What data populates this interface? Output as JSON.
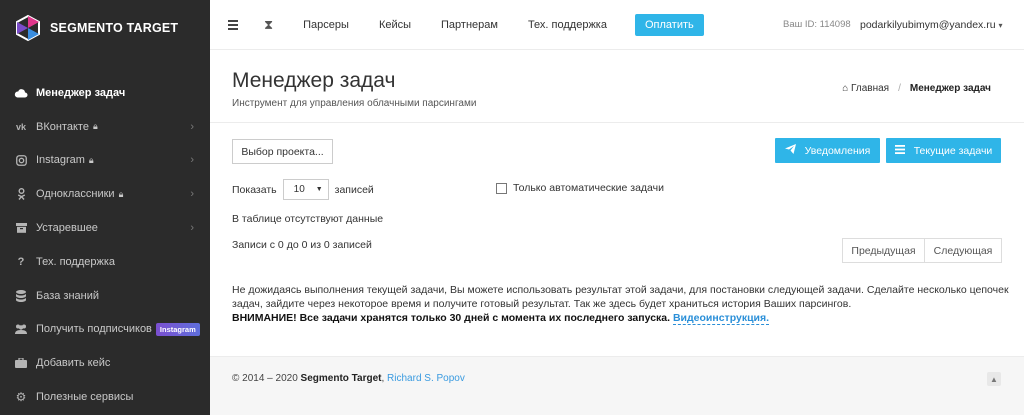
{
  "brand": {
    "title": "SEGMENTO TARGET"
  },
  "sidebar": {
    "items": [
      {
        "label": "Менеджер задач",
        "icon": "cloud-icon",
        "active": true,
        "locked": false,
        "chevron": false
      },
      {
        "label": "ВКонтакте",
        "icon": "vk-icon",
        "active": false,
        "locked": true,
        "chevron": true
      },
      {
        "label": "Instagram",
        "icon": "instagram-icon",
        "active": false,
        "locked": true,
        "chevron": true
      },
      {
        "label": "Одноклассники",
        "icon": "ok-icon",
        "active": false,
        "locked": true,
        "chevron": true
      },
      {
        "label": "Устаревшее",
        "icon": "archive-icon",
        "active": false,
        "locked": false,
        "chevron": true
      },
      {
        "label": "Тех. поддержка",
        "icon": "question-icon",
        "active": false,
        "locked": false,
        "chevron": false
      },
      {
        "label": "База знаний",
        "icon": "database-icon",
        "active": false,
        "locked": false,
        "chevron": false
      },
      {
        "label": "Получить подписчиков",
        "icon": "users-icon",
        "active": false,
        "locked": false,
        "chevron": false,
        "badge": "Instagram"
      },
      {
        "label": "Добавить кейс",
        "icon": "briefcase-icon",
        "active": false,
        "locked": false,
        "chevron": false
      },
      {
        "label": "Полезные сервисы",
        "icon": "cogs-icon",
        "active": false,
        "locked": false,
        "chevron": false
      }
    ]
  },
  "topbar": {
    "links": [
      "Парсеры",
      "Кейсы",
      "Партнерам",
      "Тех. поддержка"
    ],
    "pay_label": "Оплатить",
    "user_id": "Ваш ID: 114098",
    "user_email": "podarkilyubimym@yandex.ru"
  },
  "header": {
    "title": "Менеджер задач",
    "subtitle": "Инструмент для управления облачными парсингами",
    "breadcrumb_home": "Главная",
    "breadcrumb_current": "Менеджер задач"
  },
  "content": {
    "project_select": "Выбор проекта...",
    "notifications_label": "Уведомления",
    "current_tasks_label": "Текущие задачи",
    "show_label": "Показать",
    "page_size": "10",
    "entries_label": "записей",
    "auto_only_label": "Только автоматические задачи",
    "empty_text": "В таблице отсутствуют данные",
    "records_info": "Записи с 0 до 0 из 0 записей",
    "prev_label": "Предыдущая",
    "next_label": "Следующая",
    "notice_text": "Не дожидаясь выполнения текущей задачи, Вы можете использовать результат этой задачи, для постановки следующей задачи. Сделайте несколько цепочек задач, зайдите через некоторое время и получите готовый результат. Так же здесь будет храниться история Ваших парсингов.",
    "notice_warning": "ВНИМАНИЕ! Все задачи хранятся только 30 дней с момента их последнего запуска.",
    "notice_link": "Видеоинструкция."
  },
  "footer": {
    "copyright": "© 2014 – 2020",
    "brand": "Segmento Target",
    "author": "Richard S. Popov"
  },
  "colors": {
    "accent": "#2fb5e8",
    "sidebar_bg": "#2b2b2b"
  }
}
